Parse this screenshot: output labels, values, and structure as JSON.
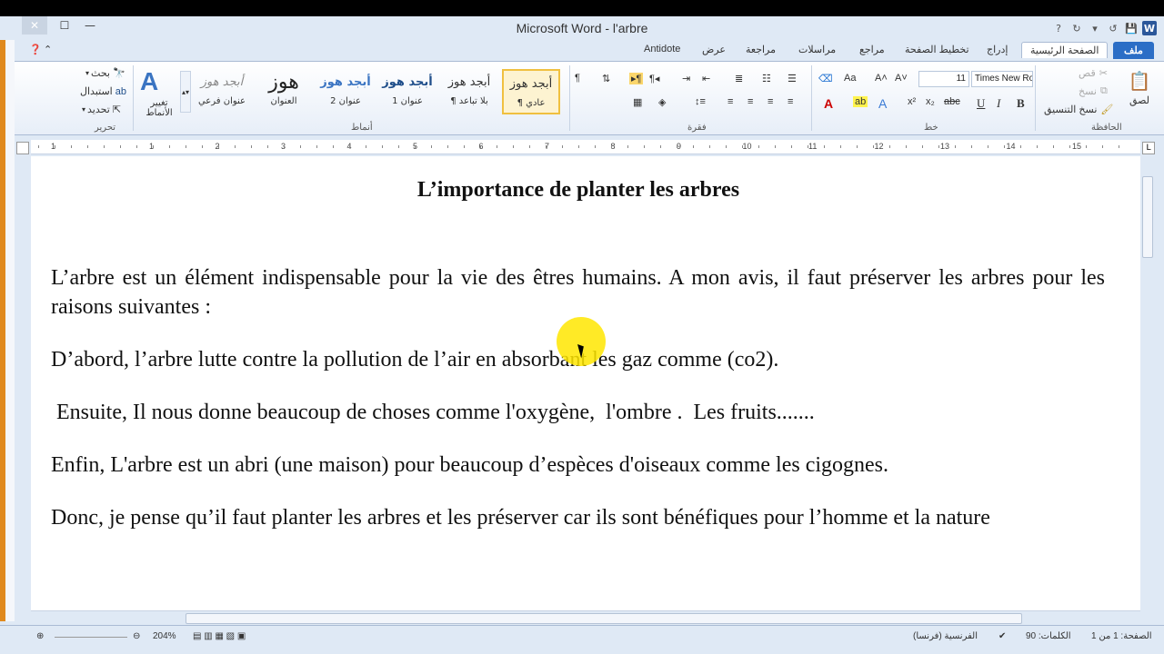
{
  "window": {
    "title": "Microsoft Word  - l'arbre"
  },
  "tabs": [
    {
      "label": "ملف"
    },
    {
      "label": "الصفحة الرئيسية"
    },
    {
      "label": "إدراج"
    },
    {
      "label": "تخطيط الصفحة"
    },
    {
      "label": "مراجع"
    },
    {
      "label": "مراسلات"
    },
    {
      "label": "مراجعة"
    },
    {
      "label": "عرض"
    },
    {
      "label": "Antidote"
    }
  ],
  "ribbon": {
    "clipboard": {
      "group_label": "الحافظة",
      "paste": "لصق",
      "cut": "قص",
      "copy": "نسخ",
      "format_painter": "نسخ التنسيق"
    },
    "font": {
      "group_label": "خط",
      "font_name": "Times New Ro",
      "font_size": "11",
      "aa_label": "Aa"
    },
    "paragraph": {
      "group_label": "فقرة"
    },
    "styles": {
      "group_label": "أنماط",
      "items": [
        {
          "preview": "أبجد هوز",
          "name": "¶ عادي"
        },
        {
          "preview": "أبجد هوز",
          "name": "¶ بلا تباعد"
        },
        {
          "preview": "أبجد هوز",
          "name": "عنوان 1"
        },
        {
          "preview": "أبجد هوز",
          "name": "عنوان 2"
        },
        {
          "preview": "هوز",
          "name": "العنوان"
        },
        {
          "preview": "أبجد هوز",
          "name": "عنوان فرعي"
        }
      ],
      "change_styles": "تغيير الأنماط"
    },
    "editing": {
      "group_label": "تحرير",
      "find": "بحث",
      "replace": "استبدال",
      "select": "تحديد"
    }
  },
  "ruler": {
    "numbers": [
      "1",
      "1",
      "2",
      "3",
      "4",
      "5",
      "6",
      "7",
      "8",
      "9",
      "10",
      "11",
      "12",
      "13",
      "14",
      "15"
    ]
  },
  "document": {
    "title": "L’importance  de planter les arbres",
    "paragraphs": [
      "L’arbre est un élément indispensable pour la vie des êtres humains. A mon avis, il faut préserver les arbres pour les raisons suivantes  :",
      "D’abord, l’arbre lutte contre la pollution  de l’air  en absorbant les gaz comme  (co2).",
      " Ensuite, Il nous donne beaucoup de choses comme l'oxygène,  l'ombre .  Les fruits.......",
      "Enfin, L'arbre est un abri (une maison)  pour beaucoup d’espèces d'oiseaux comme les cigognes.",
      "Donc, je pense qu’il faut planter les arbres et les préserver car ils sont bénéfiques pour l’homme et la nature"
    ]
  },
  "status": {
    "page": "الصفحة: 1 من 1",
    "words": "الكلمات: 90",
    "language": "الفرنسية (فرنسا)",
    "zoom": "204%"
  },
  "colors": {
    "file_tab": "#2b6ec6",
    "accent_orange": "#e08a1e",
    "cursor_highlight": "#ffe600"
  }
}
